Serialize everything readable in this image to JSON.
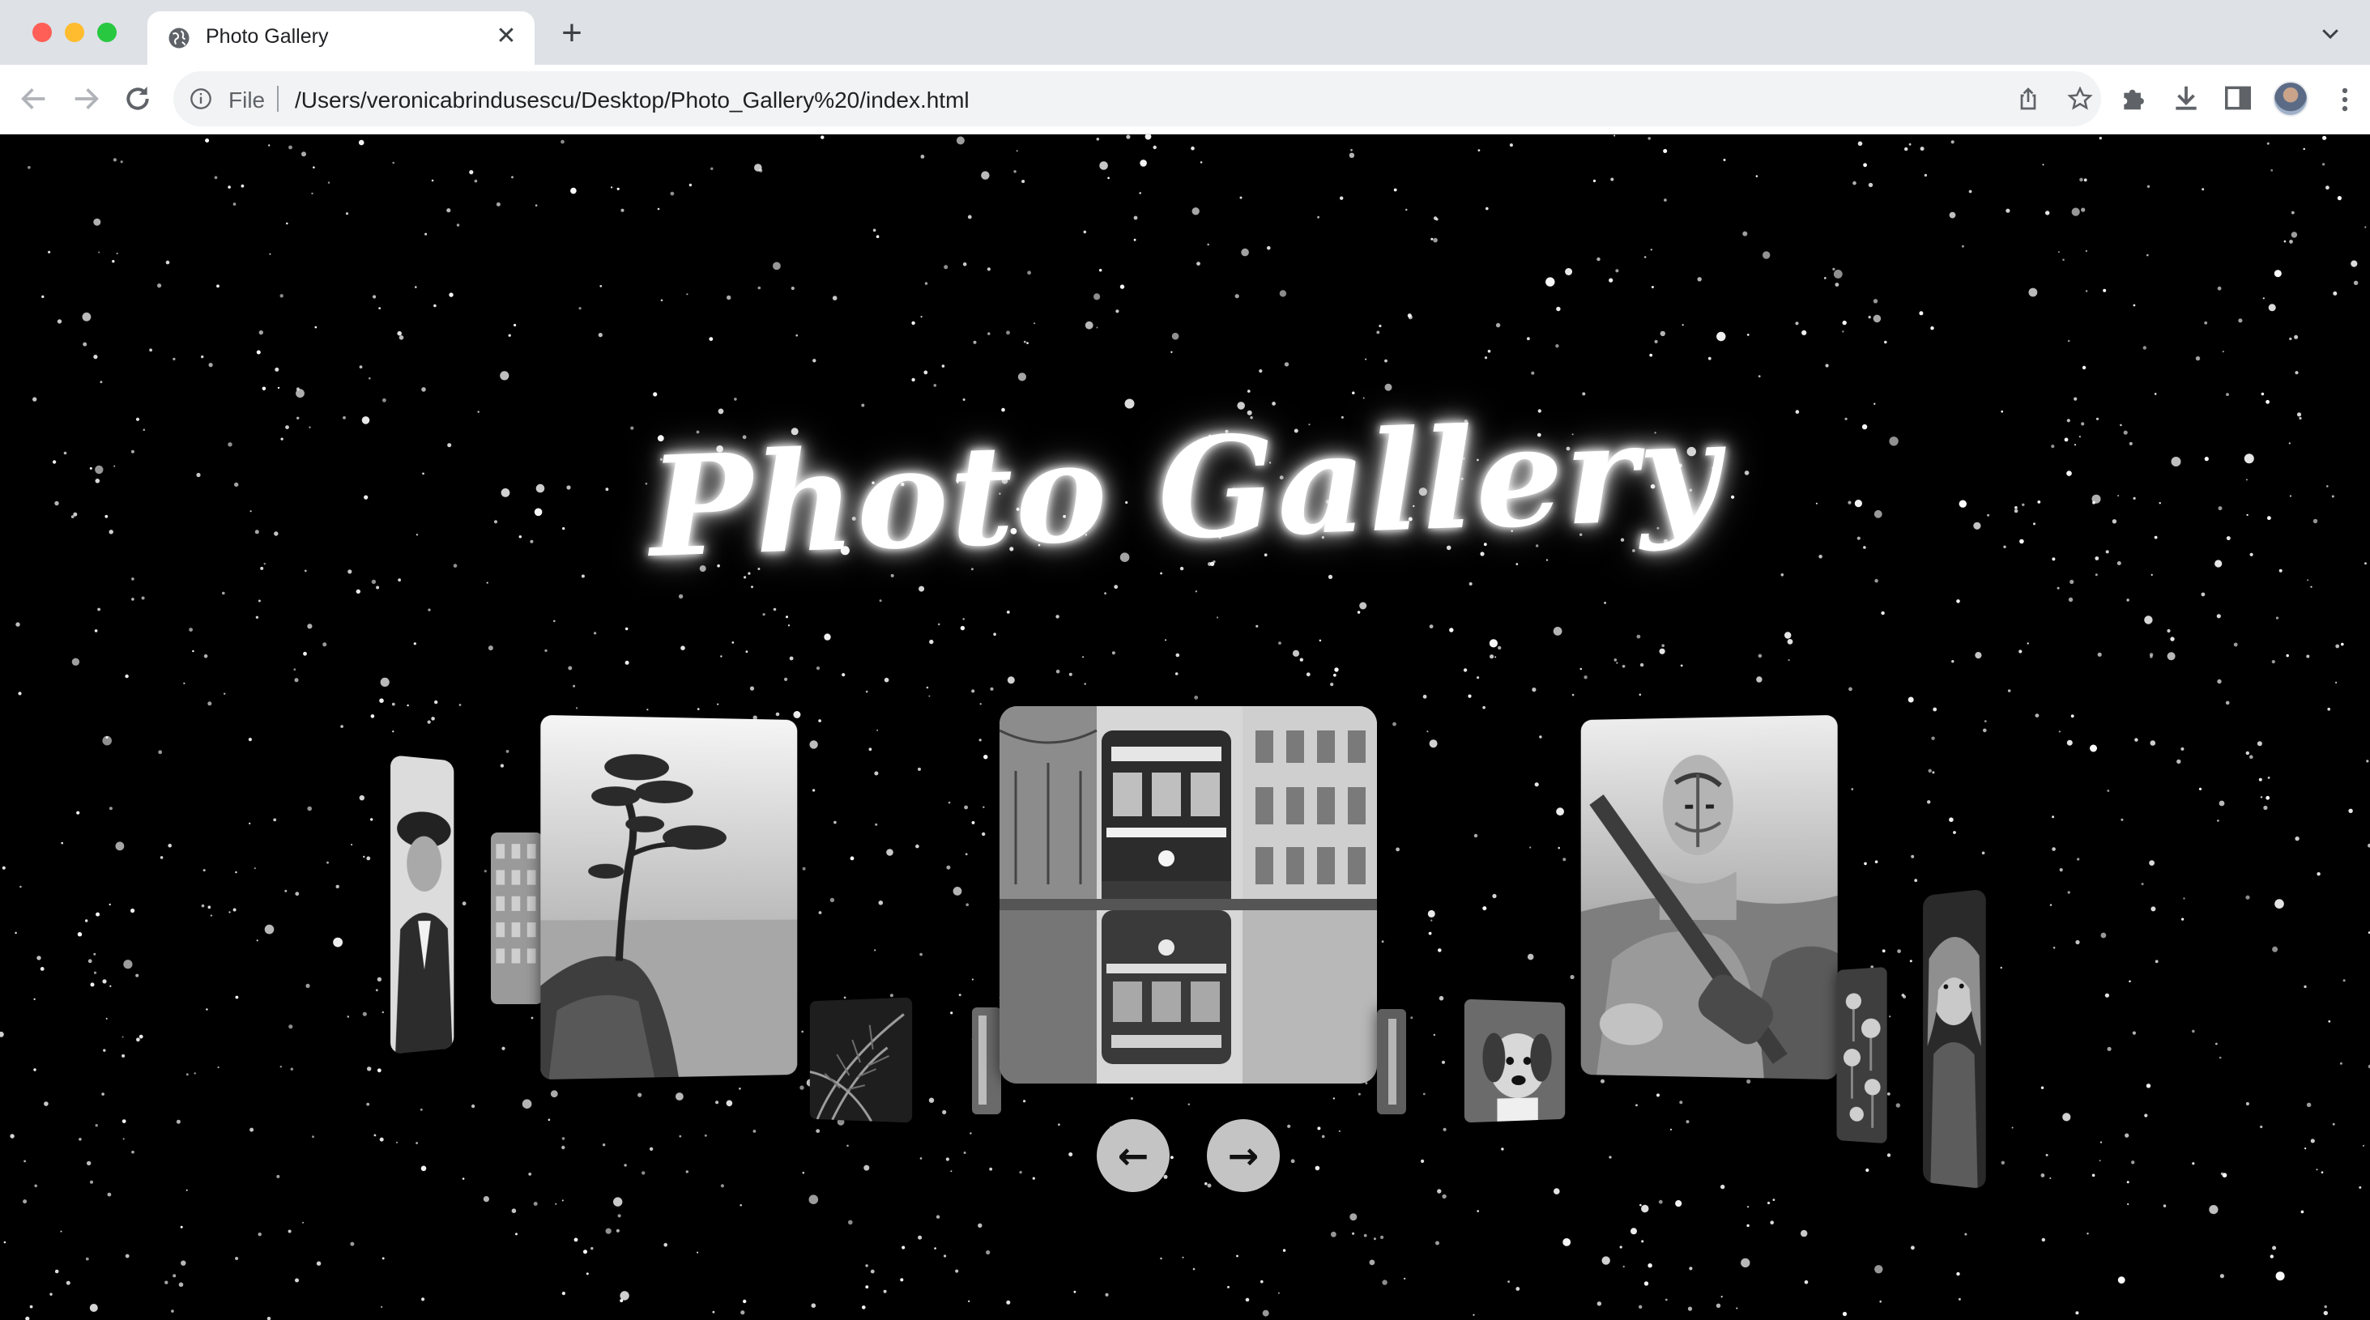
{
  "browser": {
    "tab_title": "Photo Gallery",
    "new_tab_symbol": "+",
    "close_symbol": "✕",
    "url_scheme": "File",
    "url": "/Users/veronicabrindusescu/Desktop/Photo_Gallery%20/index.html",
    "icons": [
      "globe-icon",
      "back-icon",
      "forward-icon",
      "reload-icon",
      "info-icon",
      "share-icon",
      "bookmark-star-icon",
      "extensions-icon",
      "download-icon",
      "side-panel-icon",
      "avatar",
      "more-menu-icon",
      "tab-list-icon"
    ]
  },
  "page": {
    "heading": "Photo Gallery",
    "background": "#000000",
    "prev_symbol": "←",
    "next_symbol": "→",
    "photos": [
      {
        "subject": "man in hat portrait"
      },
      {
        "subject": "city building"
      },
      {
        "subject": "cypress tree on rocky cliff by the sea"
      },
      {
        "subject": "palm leaves"
      },
      {
        "subject": "tram reflected in a puddle"
      },
      {
        "subject": "dog"
      },
      {
        "subject": "tribal man with painted face"
      },
      {
        "subject": "flowers"
      },
      {
        "subject": "girl portrait"
      }
    ],
    "button_color": "#c4c4c4"
  }
}
